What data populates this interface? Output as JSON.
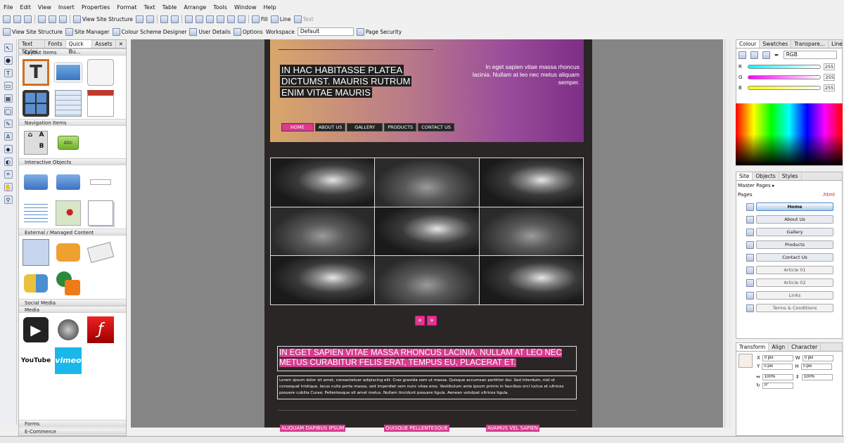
{
  "menu": [
    "File",
    "Edit",
    "View",
    "Insert",
    "Properties",
    "Format",
    "Text",
    "Table",
    "Arrange",
    "Tools",
    "Window",
    "Help"
  ],
  "toolbar1": {
    "view_site_structure": "View Site Structure",
    "fill": "Fill",
    "line": "Line",
    "text": "Text"
  },
  "toolbar2": {
    "view_site_structure": "View Site Structure",
    "site_manager": "Site Manager",
    "colour_scheme": "Colour Scheme Designer",
    "user_details": "User Details",
    "options": "Options",
    "workspace_label": "Workspace",
    "workspace_value": "Default",
    "page_security": "Page Security"
  },
  "assets_panel": {
    "tabs": [
      "Text Styles",
      "Fonts",
      "Quick Bu...",
      "Assets"
    ],
    "sections": {
      "layout": "Layout Items",
      "navigation": "Navigation Items",
      "interactive": "Interactive Objects",
      "external": "External / Managed Content",
      "social": "Social Media",
      "media": "Media",
      "forms": "Forms",
      "ecommerce": "E-Commerce"
    },
    "nav_abc": "Abc",
    "youtube": "YouTube",
    "vimeo": "vimeo"
  },
  "page": {
    "headline": [
      "IN HAC HABITASSE PLATEA",
      "DICTUMST. MAURIS RUTRUM",
      "ENIM VITAE MAURIS"
    ],
    "header_right": "In eget sapien vitae massa rhoncus lacinia. Nullam at leo nec metus aliquam semper.",
    "nav": [
      "HOME",
      "ABOUT US",
      "GALLERY",
      "PRODUCTS",
      "CONTACT US"
    ],
    "arrow_prev": "«",
    "arrow_next": "»",
    "subheading": "IN EGET SAPIEN VITAE MASSA RHONCUS LACINIA. NULLAM AT LEO NEC METUS CURABITUR FELIS ERAT, TEMPUS EU, PLACERAT ET.",
    "body": "Lorem ipsum dolor sit amet, consectetuer adipiscing elit. Cras gravida sem ut massa. Quisque accumsan porttitor dui. Sed interdum, nisl ut consequat tristique, lacus nulla porta massa, sed imperdiet sem nunc vitae eros. Vestibulum ante ipsum primis in faucibus orci luctus et ultrices posuere cubilia Curae; Pellentesque sit amet metus. Nullam tincidunt posuere ligula. Aenean volutpat ultrices ligula.",
    "bottom": [
      "ALIQUAM DAPIBUS IPSUM",
      "QUISQUE PELLENTESQUE",
      "AVAMUS VEL SAPIEN"
    ]
  },
  "colour_panel": {
    "tabs": [
      "Colour",
      "Swatches",
      "Transpare...",
      "Line"
    ],
    "mode": "RGB",
    "r_label": "R",
    "g_label": "G",
    "b_label": "B",
    "r": "255",
    "g": "255",
    "b": "255"
  },
  "site_panel": {
    "tabs": [
      "Site",
      "Objects",
      "Styles"
    ],
    "master_pages": "Master Pages",
    "pages_label": "Pages",
    "html_label": ".html",
    "pages": [
      "Home",
      "About Us",
      "Gallery",
      "Products",
      "Contact Us",
      "Article 01",
      "Article 02",
      "Links",
      "Terms & Conditions"
    ]
  },
  "transform_panel": {
    "tabs": [
      "Transform",
      "Align",
      "Character"
    ],
    "x_label": "X",
    "y_label": "Y",
    "w_label": "W",
    "h_label": "H",
    "x": "0 pix",
    "y": "0 pix",
    "w": "0 pix",
    "h": "0 pix",
    "scale_w": "100%",
    "scale_h": "100%",
    "rotate": "0°"
  }
}
